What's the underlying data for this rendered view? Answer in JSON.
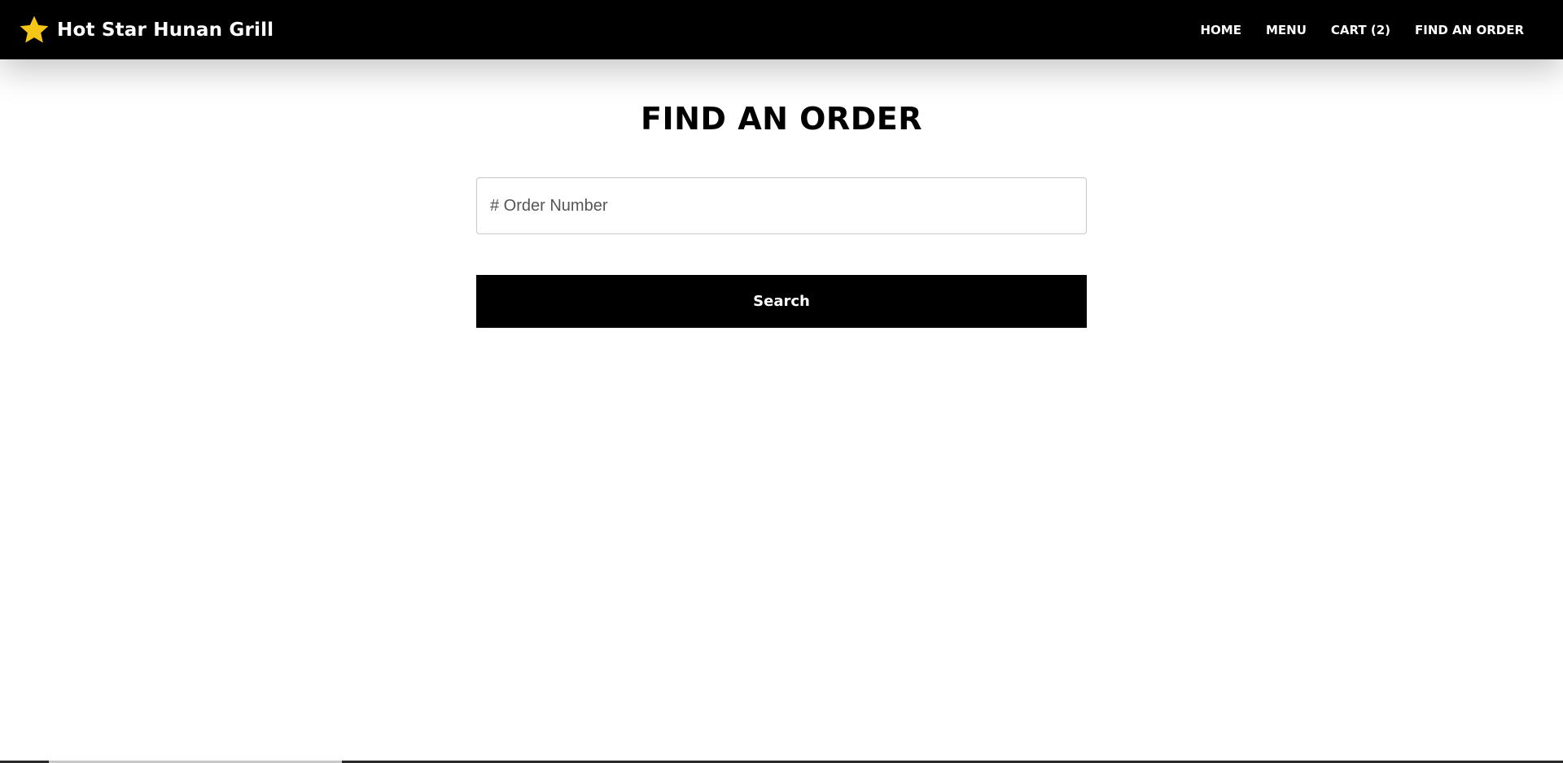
{
  "header": {
    "brand_name": "Hot Star Hunan Grill",
    "brand_icon": "star-icon",
    "accent_color": "#F5C518",
    "nav": [
      {
        "label": "HOME"
      },
      {
        "label": "MENU"
      },
      {
        "label": "CART (2)"
      },
      {
        "label": "FIND AN ORDER"
      }
    ]
  },
  "main": {
    "title": "FIND AN ORDER",
    "order_input": {
      "placeholder": "# Order Number",
      "value": ""
    },
    "search_label": "Search"
  }
}
